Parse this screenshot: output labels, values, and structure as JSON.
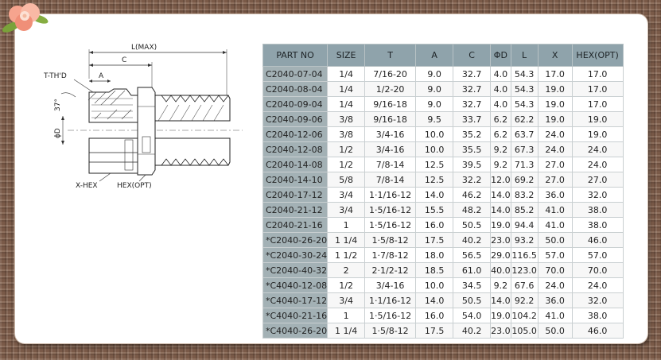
{
  "drawing": {
    "labels": {
      "length": "L(MAX)",
      "c_dim": "C",
      "thread": "T-TH'D",
      "a_dim": "A",
      "angle": "37°",
      "diameter": "ϕD",
      "x_hex": "X-HEX",
      "hex_opt": "HEX(OPT)"
    }
  },
  "table": {
    "headers": [
      "PART NO",
      "SIZE",
      "T",
      "A",
      "C",
      "ΦD",
      "L",
      "X",
      "HEX(OPT)"
    ],
    "rows": [
      [
        "C2040-07-04",
        "1/4",
        "7/16-20",
        "9.0",
        "32.7",
        "4.0",
        "54.3",
        "17.0",
        "17.0"
      ],
      [
        "C2040-08-04",
        "1/4",
        "1/2-20",
        "9.0",
        "32.7",
        "4.0",
        "54.3",
        "19.0",
        "17.0"
      ],
      [
        "C2040-09-04",
        "1/4",
        "9/16-18",
        "9.0",
        "32.7",
        "4.0",
        "54.3",
        "19.0",
        "17.0"
      ],
      [
        "C2040-09-06",
        "3/8",
        "9/16-18",
        "9.5",
        "33.7",
        "6.2",
        "62.2",
        "19.0",
        "19.0"
      ],
      [
        "C2040-12-06",
        "3/8",
        "3/4-16",
        "10.0",
        "35.2",
        "6.2",
        "63.7",
        "24.0",
        "19.0"
      ],
      [
        "C2040-12-08",
        "1/2",
        "3/4-16",
        "10.0",
        "35.5",
        "9.2",
        "67.3",
        "24.0",
        "24.0"
      ],
      [
        "C2040-14-08",
        "1/2",
        "7/8-14",
        "12.5",
        "39.5",
        "9.2",
        "71.3",
        "27.0",
        "24.0"
      ],
      [
        "C2040-14-10",
        "5/8",
        "7/8-14",
        "12.5",
        "32.2",
        "12.0",
        "69.2",
        "27.0",
        "27.0"
      ],
      [
        "C2040-17-12",
        "3/4",
        "1·1/16-12",
        "14.0",
        "46.2",
        "14.0",
        "83.2",
        "36.0",
        "32.0"
      ],
      [
        "C2040-21-12",
        "3/4",
        "1·5/16-12",
        "15.5",
        "48.2",
        "14.0",
        "85.2",
        "41.0",
        "38.0"
      ],
      [
        "C2040-21-16",
        "1",
        "1·5/16-12",
        "16.0",
        "50.5",
        "19.0",
        "94.4",
        "41.0",
        "38.0"
      ],
      [
        "*C2040-26-20",
        "1 1/4",
        "1·5/8-12",
        "17.5",
        "40.2",
        "23.0",
        "93.2",
        "50.0",
        "46.0"
      ],
      [
        "*C2040-30-24",
        "1 1/2",
        "1·7/8-12",
        "18.0",
        "56.5",
        "29.0",
        "116.5",
        "57.0",
        "57.0"
      ],
      [
        "*C2040-40-32",
        "2",
        "2·1/2-12",
        "18.5",
        "61.0",
        "40.0",
        "123.0",
        "70.0",
        "70.0"
      ],
      [
        "*C4040-12-08",
        "1/2",
        "3/4-16",
        "10.0",
        "34.5",
        "9.2",
        "67.6",
        "24.0",
        "24.0"
      ],
      [
        "*C4040-17-12",
        "3/4",
        "1·1/16-12",
        "14.0",
        "50.5",
        "14.0",
        "92.2",
        "36.0",
        "32.0"
      ],
      [
        "*C4040-21-16",
        "1",
        "1·5/16-12",
        "16.0",
        "54.0",
        "19.0",
        "104.2",
        "41.0",
        "38.0"
      ],
      [
        "*C4040-26-20",
        "1 1/4",
        "1·5/8-12",
        "17.5",
        "40.2",
        "23.0",
        "105.0",
        "50.0",
        "46.0"
      ]
    ]
  }
}
